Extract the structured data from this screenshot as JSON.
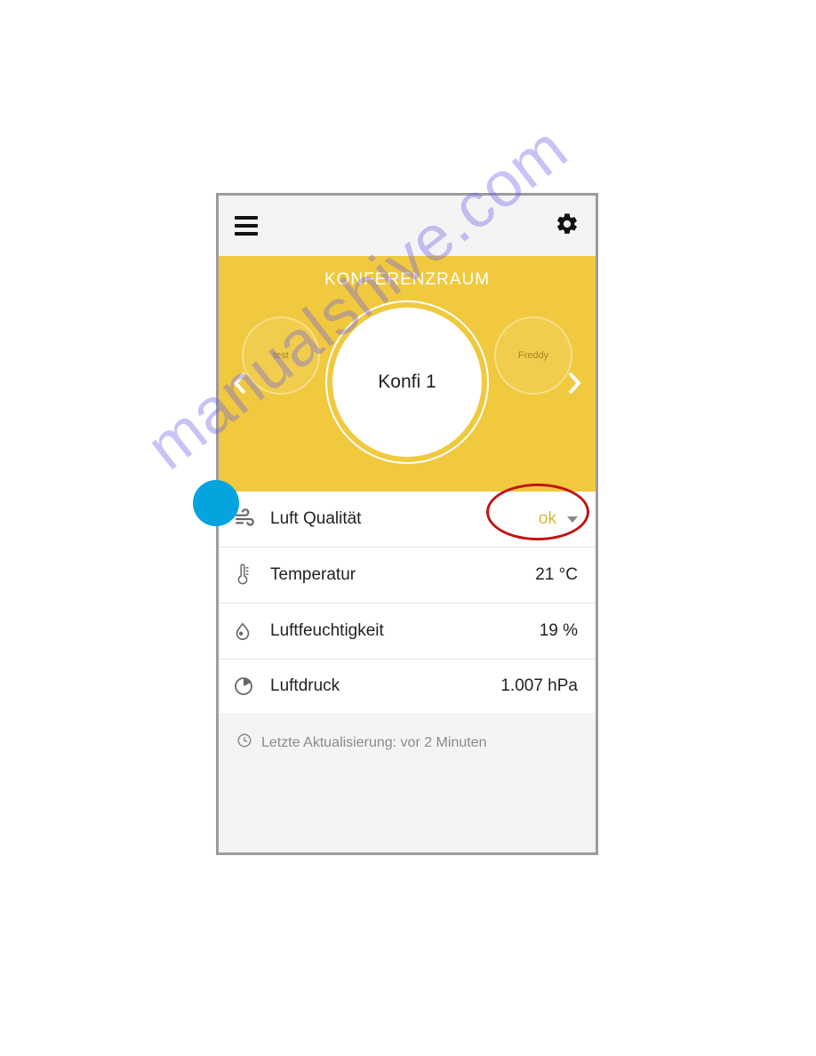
{
  "watermark": "manualshive.com",
  "hero": {
    "title": "KONFERENZRAUM",
    "prev_label": "test",
    "current_label": "Konfi 1",
    "next_label": "Freddy"
  },
  "metrics": {
    "air_quality": {
      "label": "Luft Qualität",
      "value": "ok"
    },
    "temperature": {
      "label": "Temperatur",
      "value": "21 °C"
    },
    "humidity": {
      "label": "Luftfeuchtigkeit",
      "value": "19 %"
    },
    "pressure": {
      "label": "Luftdruck",
      "value": "1.007 hPa"
    }
  },
  "footer": {
    "last_update": "Letzte Aktualisierung: vor 2 Minuten"
  }
}
